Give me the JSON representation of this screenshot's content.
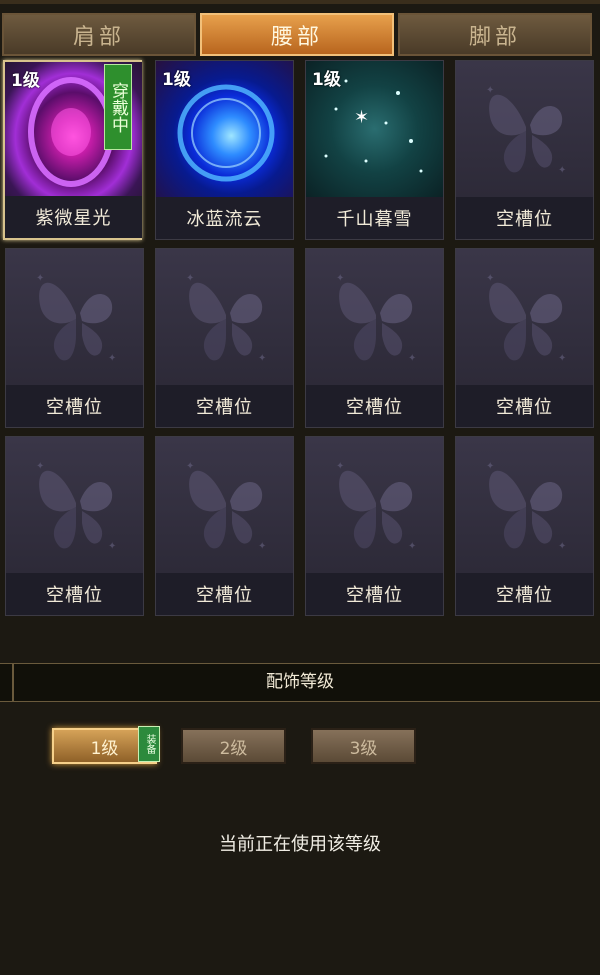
{
  "tabs": [
    {
      "label": "肩部",
      "active": false
    },
    {
      "label": "腰部",
      "active": true
    },
    {
      "label": "脚部",
      "active": false
    }
  ],
  "slots": [
    {
      "name": "紫微星光",
      "level": "1级",
      "wearing": "穿戴中",
      "art": "purple-orb-art"
    },
    {
      "name": "冰蓝流云",
      "level": "1级",
      "art": "blue-swirl-art"
    },
    {
      "name": "千山暮雪",
      "level": "1级",
      "art": "snow-sparkle-art"
    },
    {
      "name": "空槽位"
    },
    {
      "name": "空槽位"
    },
    {
      "name": "空槽位"
    },
    {
      "name": "空槽位"
    },
    {
      "name": "空槽位"
    },
    {
      "name": "空槽位"
    },
    {
      "name": "空槽位"
    },
    {
      "name": "空槽位"
    },
    {
      "name": "空槽位"
    }
  ],
  "section": {
    "title": "配饰等级"
  },
  "levels": [
    {
      "label": "1级",
      "active": true,
      "badge": "装备"
    },
    {
      "label": "2级",
      "active": false
    },
    {
      "label": "3级",
      "active": false
    }
  ],
  "status_text": "当前正在使用该等级",
  "colors": {
    "active_tab": "#d98a38",
    "badge_green": "#2e8f2d",
    "slot_bg": "#332f40"
  }
}
